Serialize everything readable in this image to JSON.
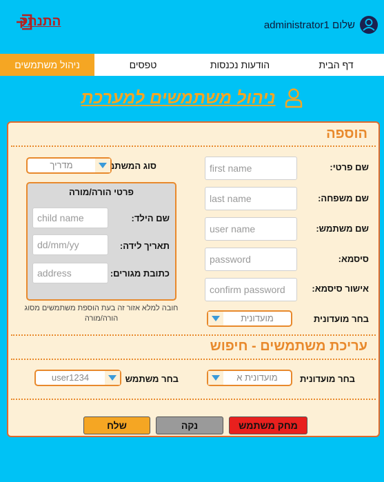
{
  "header": {
    "logout_label": "התנתק",
    "greeting": "שלום administrator1"
  },
  "nav": {
    "tabs": [
      {
        "label": "ניהול משתמשים",
        "active": true
      },
      {
        "label": "טפסים",
        "active": false
      },
      {
        "label": "הודעות נכנסות",
        "active": false
      },
      {
        "label": "דף הבית",
        "active": false
      }
    ]
  },
  "page": {
    "title": "ניהול משתמשים למערכת"
  },
  "add_section": {
    "title": "הוספה",
    "first_name": {
      "label": "שם פרטי:",
      "placeholder": "first name"
    },
    "last_name": {
      "label": "שם משפחה:",
      "placeholder": "last name"
    },
    "username": {
      "label": "שם משתמש:",
      "placeholder": "user name"
    },
    "password": {
      "label": "סיסמא:",
      "placeholder": "password"
    },
    "confirm_password": {
      "label": "אישור סיסמא:",
      "placeholder": "confirm password"
    },
    "club": {
      "label": "בחר מועדונית",
      "selected": "מועדונית"
    },
    "user_type": {
      "label": "סוג המשתמש:",
      "selected": "מדריך"
    },
    "parent_details": {
      "title": "פרטי הורה/מורה",
      "child_name": {
        "label": "שם הילד:",
        "placeholder": "child name"
      },
      "birth_date": {
        "label": "תאריך לידה:",
        "placeholder": "dd/mm/yy"
      },
      "address": {
        "label": "כתובת מגורים:",
        "placeholder": "address"
      }
    },
    "note": "חובה למלא אזור זה בעת הוספת משתמשים מסוג הורה/מורה"
  },
  "edit_section": {
    "title": "עריכת משתמשים - חיפוש",
    "club": {
      "label": "בחר מועדונית",
      "selected": "מועדונית א"
    },
    "user": {
      "label": "בחר משתמש",
      "selected": "user1234"
    }
  },
  "buttons": {
    "delete_label": "מחק משתמש",
    "clear_label": "נקה",
    "send_label": "שלח"
  },
  "colors": {
    "background": "#00c2f5",
    "accent": "#f5a623",
    "panel": "#fdf0d6",
    "delete": "#e8201e",
    "clear": "#9a9a9a",
    "logout": "#b22222"
  }
}
